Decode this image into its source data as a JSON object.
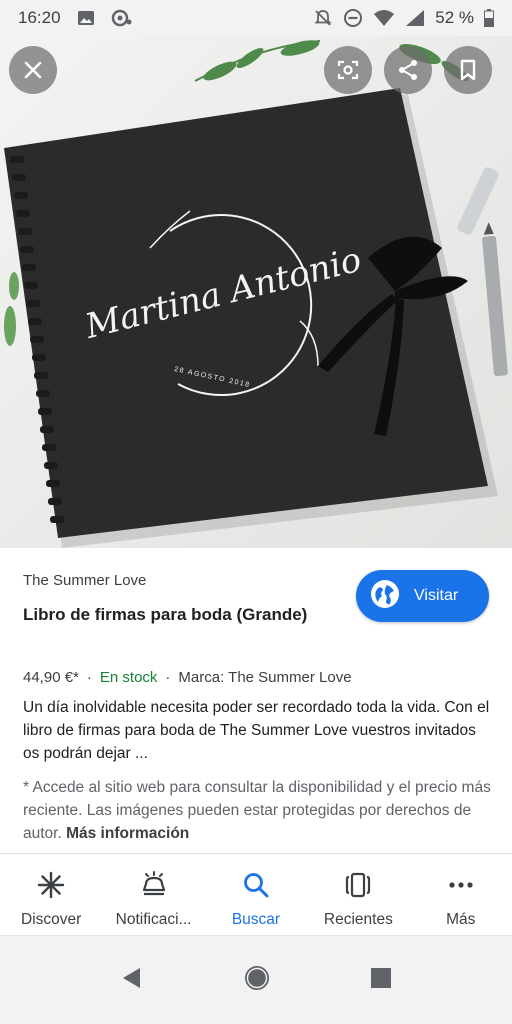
{
  "status_bar": {
    "time": "16:20",
    "battery": "52 %"
  },
  "hero": {
    "cover_names": "Martina Antonio",
    "cover_date": "28 AGOSTO 2018"
  },
  "product": {
    "source": "The Summer Love",
    "title": "Libro de firmas para boda (Grande)",
    "price": "44,90 €*",
    "separator": "·",
    "stock": "En stock",
    "brand": "Marca: The Summer Love",
    "description": "Un día inolvidable necesita poder ser recordado toda la vida. Con el libro de firmas para boda de The Summer Love vuestros invitados os podrán dejar ...",
    "note": "* Accede al sitio web para consultar la disponibilidad y el precio más reciente. Las imágenes pueden estar protegidas por derechos de autor.",
    "more_info": "Más información"
  },
  "visit_button": {
    "label": "Visitar"
  },
  "bottom_nav": [
    {
      "label": "Discover",
      "icon": "asterisk-icon"
    },
    {
      "label": "Notificaci...",
      "icon": "bell-icon"
    },
    {
      "label": "Buscar",
      "icon": "search-icon"
    },
    {
      "label": "Recientes",
      "icon": "recents-icon"
    },
    {
      "label": "Más",
      "icon": "more-icon"
    }
  ],
  "colors": {
    "accent": "#1a73e8",
    "stock_green": "#188038"
  }
}
